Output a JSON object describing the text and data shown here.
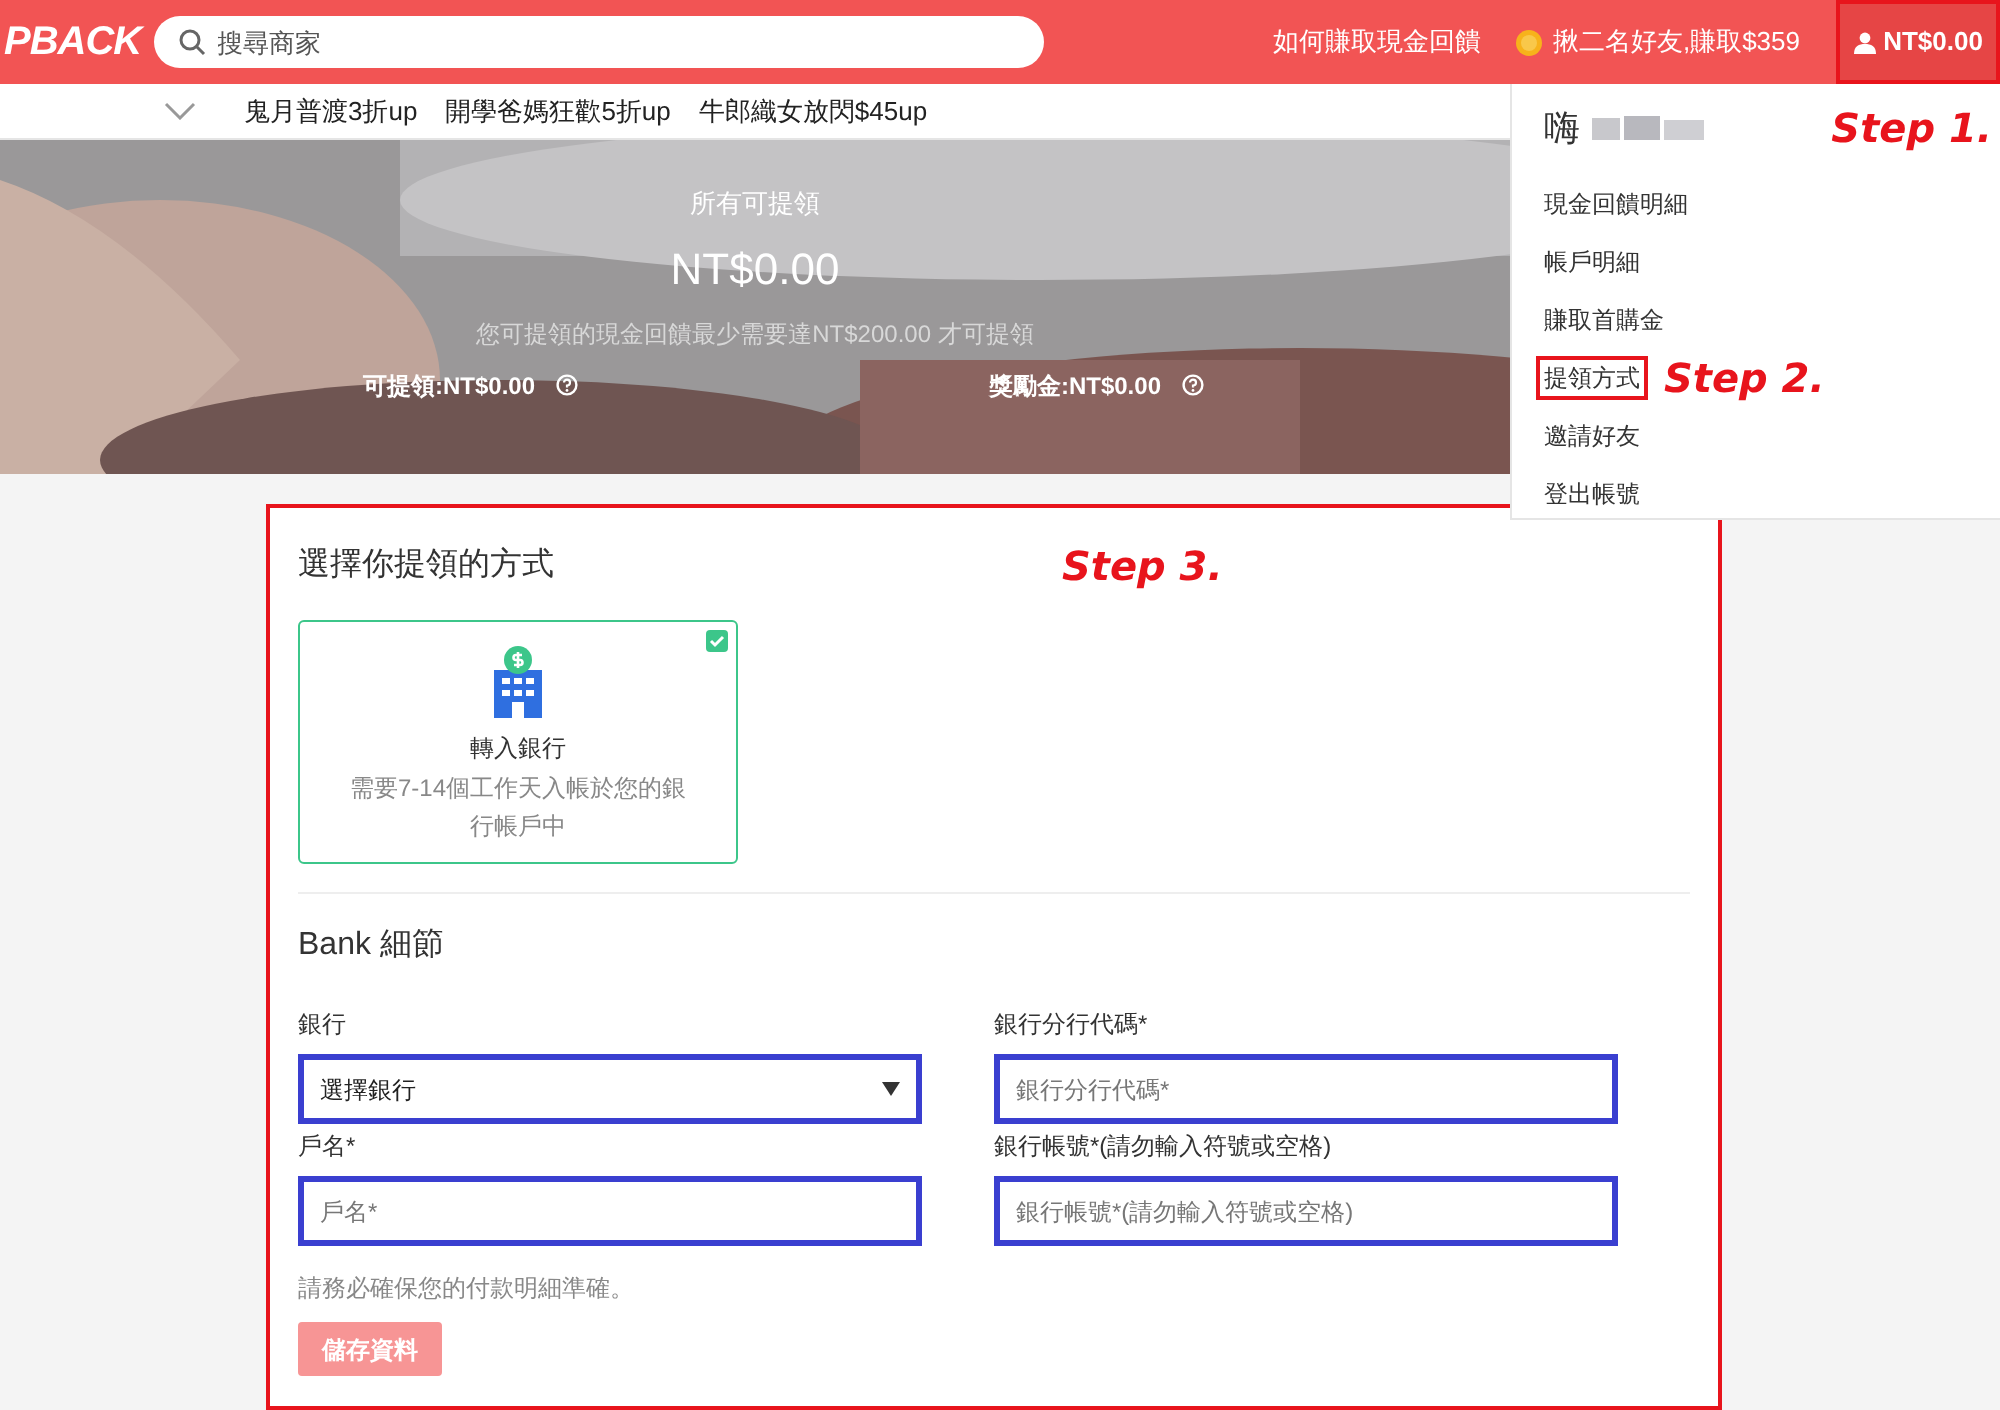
{
  "header": {
    "logo": "PBACK",
    "search": {
      "placeholder": "搜尋商家"
    },
    "links": [
      {
        "kind": "text",
        "label": "如何賺取現金回饋"
      },
      {
        "kind": "coin",
        "label": "揪二名好友,賺取$359"
      }
    ],
    "account": {
      "label": "NT$0.00",
      "highlighted": true
    }
  },
  "subnav": {
    "items": [
      "鬼月普渡3折up",
      "開學爸媽狂歡5折up",
      "牛郎織女放閃$45up"
    ]
  },
  "hero": {
    "title": "所有可提領",
    "amount": "NT$0.00",
    "note": "您可提領的現金回饋最少需要達NT$200.00 才可提領",
    "balances": [
      "可提領:NT$0.00",
      "獎勵金:NT$0.00"
    ]
  },
  "menu": {
    "greeting": "嗨",
    "items": [
      {
        "label": "現金回饋明細",
        "highlighted": false
      },
      {
        "label": "帳戶明細",
        "highlighted": false
      },
      {
        "label": "賺取首購金",
        "highlighted": false
      },
      {
        "label": "提領方式",
        "highlighted": true
      },
      {
        "label": "邀請好友",
        "highlighted": false
      },
      {
        "label": "登出帳號",
        "highlighted": false
      }
    ]
  },
  "annotations": [
    "Step 1.",
    "Step 2.",
    "Step 3."
  ],
  "withdraw": {
    "highlighted": true,
    "title": "選擇你提領的方式",
    "methods": [
      {
        "name": "轉入銀行",
        "description": "需要7-14個工作天入帳於您的銀行帳戶中",
        "selected": true
      }
    ],
    "bank_title": "Bank 細節",
    "fields": [
      {
        "kind": "select",
        "label": "銀行",
        "value": "選擇銀行",
        "highlighted": true
      },
      {
        "kind": "input",
        "label": "銀行分行代碼*",
        "placeholder": "銀行分行代碼*",
        "highlighted": true
      },
      {
        "kind": "input",
        "label": "戶名*",
        "placeholder": "戶名*",
        "highlighted": true
      },
      {
        "kind": "input",
        "label": "銀行帳號*(請勿輸入符號或空格)",
        "placeholder": "銀行帳號*(請勿輸入符號或空格)",
        "highlighted": true
      }
    ],
    "notice": "請務必確保您的付款明細準確。",
    "save_button": "儲存資料"
  }
}
